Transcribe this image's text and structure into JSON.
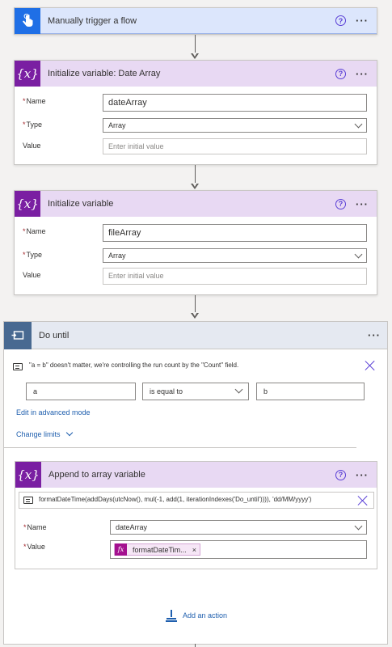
{
  "trigger": {
    "title": "Manually trigger a flow",
    "help": "?",
    "more": "···"
  },
  "init_date_array": {
    "title": "Initialize variable: Date Array",
    "icon": "{x}",
    "help": "?",
    "more": "···",
    "name_label": "Name",
    "name_value": "dateArray",
    "type_label": "Type",
    "type_value": "Array",
    "value_label": "Value",
    "value_placeholder": "Enter initial value"
  },
  "init_file_array": {
    "title": "Initialize variable",
    "icon": "{x}",
    "help": "?",
    "more": "···",
    "name_label": "Name",
    "name_value": "fileArray",
    "type_label": "Type",
    "type_value": "Array",
    "value_label": "Value",
    "value_placeholder": "Enter initial value"
  },
  "do_until": {
    "title": "Do until",
    "more": "···",
    "comment": "\"a = b\" doesn't matter, we're controlling the run count by the \"Count\" field.",
    "left_operand": "a",
    "operator": "is equal to",
    "right_operand": "b",
    "advanced_link": "Edit in advanced mode",
    "change_limits": "Change limits",
    "add_action": "Add an action"
  },
  "append_action": {
    "title": "Append to array variable",
    "icon": "{x}",
    "help": "?",
    "more": "···",
    "comment": "formatDateTime(addDays(utcNow(), mul(-1, add(1, iterationIndexes('Do_until')))), 'dd/MM/yyyy')",
    "name_label": "Name",
    "name_value": "dateArray",
    "value_label": "Value",
    "token_fx": "fx",
    "token_label": "formatDateTim...",
    "token_remove": "×"
  },
  "colors": {
    "trigger_header": "#dce6fc",
    "trigger_icon": "#1f6fe6",
    "variable_header": "#e8d9f3",
    "variable_icon": "#7a1fa2",
    "do_until_icon": "#486991",
    "link": "#1f5fae"
  }
}
